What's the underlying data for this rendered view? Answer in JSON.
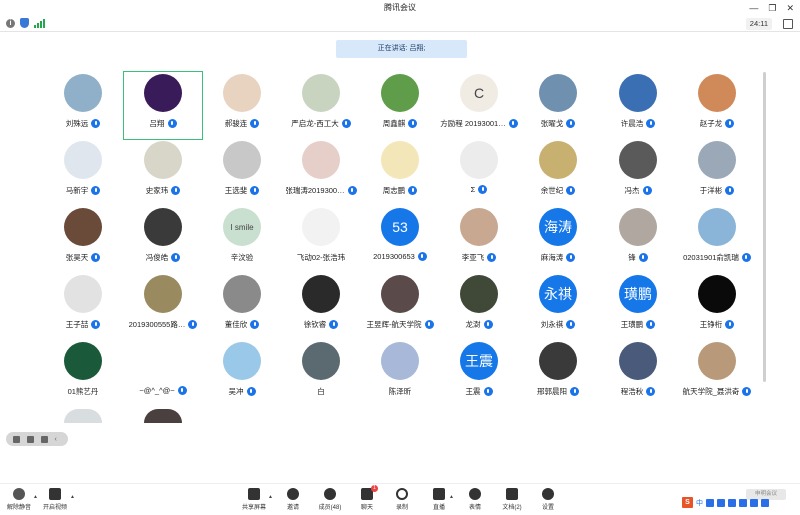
{
  "window": {
    "title": "腾讯会议"
  },
  "topbar": {
    "clock": "24:11"
  },
  "speaking_banner": "正在讲话: 吕翔;",
  "participants": [
    {
      "name": "刘殊远",
      "mic": true,
      "bg": "#8fb0c8"
    },
    {
      "name": "吕翔",
      "mic": true,
      "bg": "#3a1b5a",
      "active": true
    },
    {
      "name": "郝骏连",
      "mic": true,
      "bg": "#e8d3c1"
    },
    {
      "name": "严启龙-西工大",
      "mic": true,
      "bg": "#c9d4c0"
    },
    {
      "name": "周鑫麒",
      "mic": true,
      "bg": "#5f9d4a"
    },
    {
      "name": "方励程 20193001…",
      "mic": true,
      "bg": "#f0ece4",
      "text": "C"
    },
    {
      "name": "张曜戈",
      "mic": true,
      "bg": "#7090b0"
    },
    {
      "name": "许晨浩",
      "mic": true,
      "bg": "#3b6fb3"
    },
    {
      "name": "赵子龙",
      "mic": true,
      "bg": "#d08a5a"
    },
    {
      "name": "马新宇",
      "mic": true,
      "bg": "#dfe6ee"
    },
    {
      "name": "史家玮",
      "mic": true,
      "bg": "#d8d6c8"
    },
    {
      "name": "王选斐",
      "mic": true,
      "bg": "#c8c8c8"
    },
    {
      "name": "张瑞涛2019300…",
      "mic": true,
      "bg": "#e6cfc8"
    },
    {
      "name": "周志鹏",
      "mic": true,
      "bg": "#f3e6b8"
    },
    {
      "name": "Σ",
      "mic": true,
      "bg": "#ececec"
    },
    {
      "name": "余世纪",
      "mic": true,
      "bg": "#c8b070"
    },
    {
      "name": "冯杰",
      "mic": true,
      "bg": "#5a5a5a"
    },
    {
      "name": "于洋彬",
      "mic": true,
      "bg": "#9aa8b8"
    },
    {
      "name": "张昊天",
      "mic": true,
      "bg": "#6a4a38"
    },
    {
      "name": "冯俊皓",
      "mic": true,
      "bg": "#3a3a3a"
    },
    {
      "name": "辛汶验",
      "mic": false,
      "bg": "#c9dfcf",
      "text": "I smile"
    },
    {
      "name": "飞动02-张浩玮",
      "mic": false,
      "bg": "#f2f2f2"
    },
    {
      "name": "2019300653",
      "mic": true,
      "bg": "#1677e8",
      "text": "53",
      "blue": true
    },
    {
      "name": "李亚飞",
      "mic": true,
      "bg": "#c8a890"
    },
    {
      "name": "麻海涛",
      "mic": true,
      "bg": "#1677e8",
      "text": "海涛",
      "blue": true
    },
    {
      "name": "锋",
      "mic": true,
      "bg": "#b0a8a0"
    },
    {
      "name": "02031901俞凯瑞",
      "mic": true,
      "bg": "#8ab4d8"
    },
    {
      "name": "王子喆",
      "mic": true,
      "bg": "#e2e2e2"
    },
    {
      "name": "2019300555路…",
      "mic": true,
      "bg": "#9a8a60"
    },
    {
      "name": "董佳欣",
      "mic": true,
      "bg": "#8a8a8a"
    },
    {
      "name": "徐钦睿",
      "mic": true,
      "bg": "#2a2a2a"
    },
    {
      "name": "王昱辉-航天学院",
      "mic": true,
      "bg": "#5a4a4a"
    },
    {
      "name": "龙澍",
      "mic": true,
      "bg": "#404838"
    },
    {
      "name": "刘永祺",
      "mic": true,
      "bg": "#1677e8",
      "text": "永祺",
      "blue": true
    },
    {
      "name": "王璜鹏",
      "mic": true,
      "bg": "#1677e8",
      "text": "璜鹏",
      "blue": true
    },
    {
      "name": "王铮桁",
      "mic": true,
      "bg": "#0a0a0a"
    },
    {
      "name": "01熊艺丹",
      "mic": false,
      "bg": "#1a5a3a"
    },
    {
      "name": "~@^_^@~",
      "mic": true,
      "bg": "#ffffff"
    },
    {
      "name": "吴冲",
      "mic": true,
      "bg": "#9ac8e8"
    },
    {
      "name": "白",
      "mic": false,
      "bg": "#5a6a70"
    },
    {
      "name": "陈泽昕",
      "mic": false,
      "bg": "#a8b8d8"
    },
    {
      "name": "王震",
      "mic": true,
      "bg": "#1677e8",
      "text": "王震",
      "blue": true
    },
    {
      "name": "邢郭晨阳",
      "mic": true,
      "bg": "#3a3a3a"
    },
    {
      "name": "程浩秋",
      "mic": true,
      "bg": "#4a5a7a"
    },
    {
      "name": "航天学院_聂洪奇",
      "mic": true,
      "bg": "#b89a7a"
    },
    {
      "name": "",
      "mic": false,
      "bg": "#d8dde0"
    },
    {
      "name": "",
      "mic": false,
      "bg": "#4a4040"
    }
  ],
  "toolbar": {
    "mute": "解除静音",
    "video": "开启视频",
    "share": "共享屏幕",
    "invite": "邀请",
    "members": "成员(48)",
    "chat": "聊天",
    "chat_badge": "1",
    "record": "录制",
    "live": "直播",
    "reactions": "表情",
    "docs": "文档(2)",
    "settings": "设置"
  },
  "ime": {
    "logo": "S",
    "mode": "中"
  },
  "ghost_button": "申明会议"
}
